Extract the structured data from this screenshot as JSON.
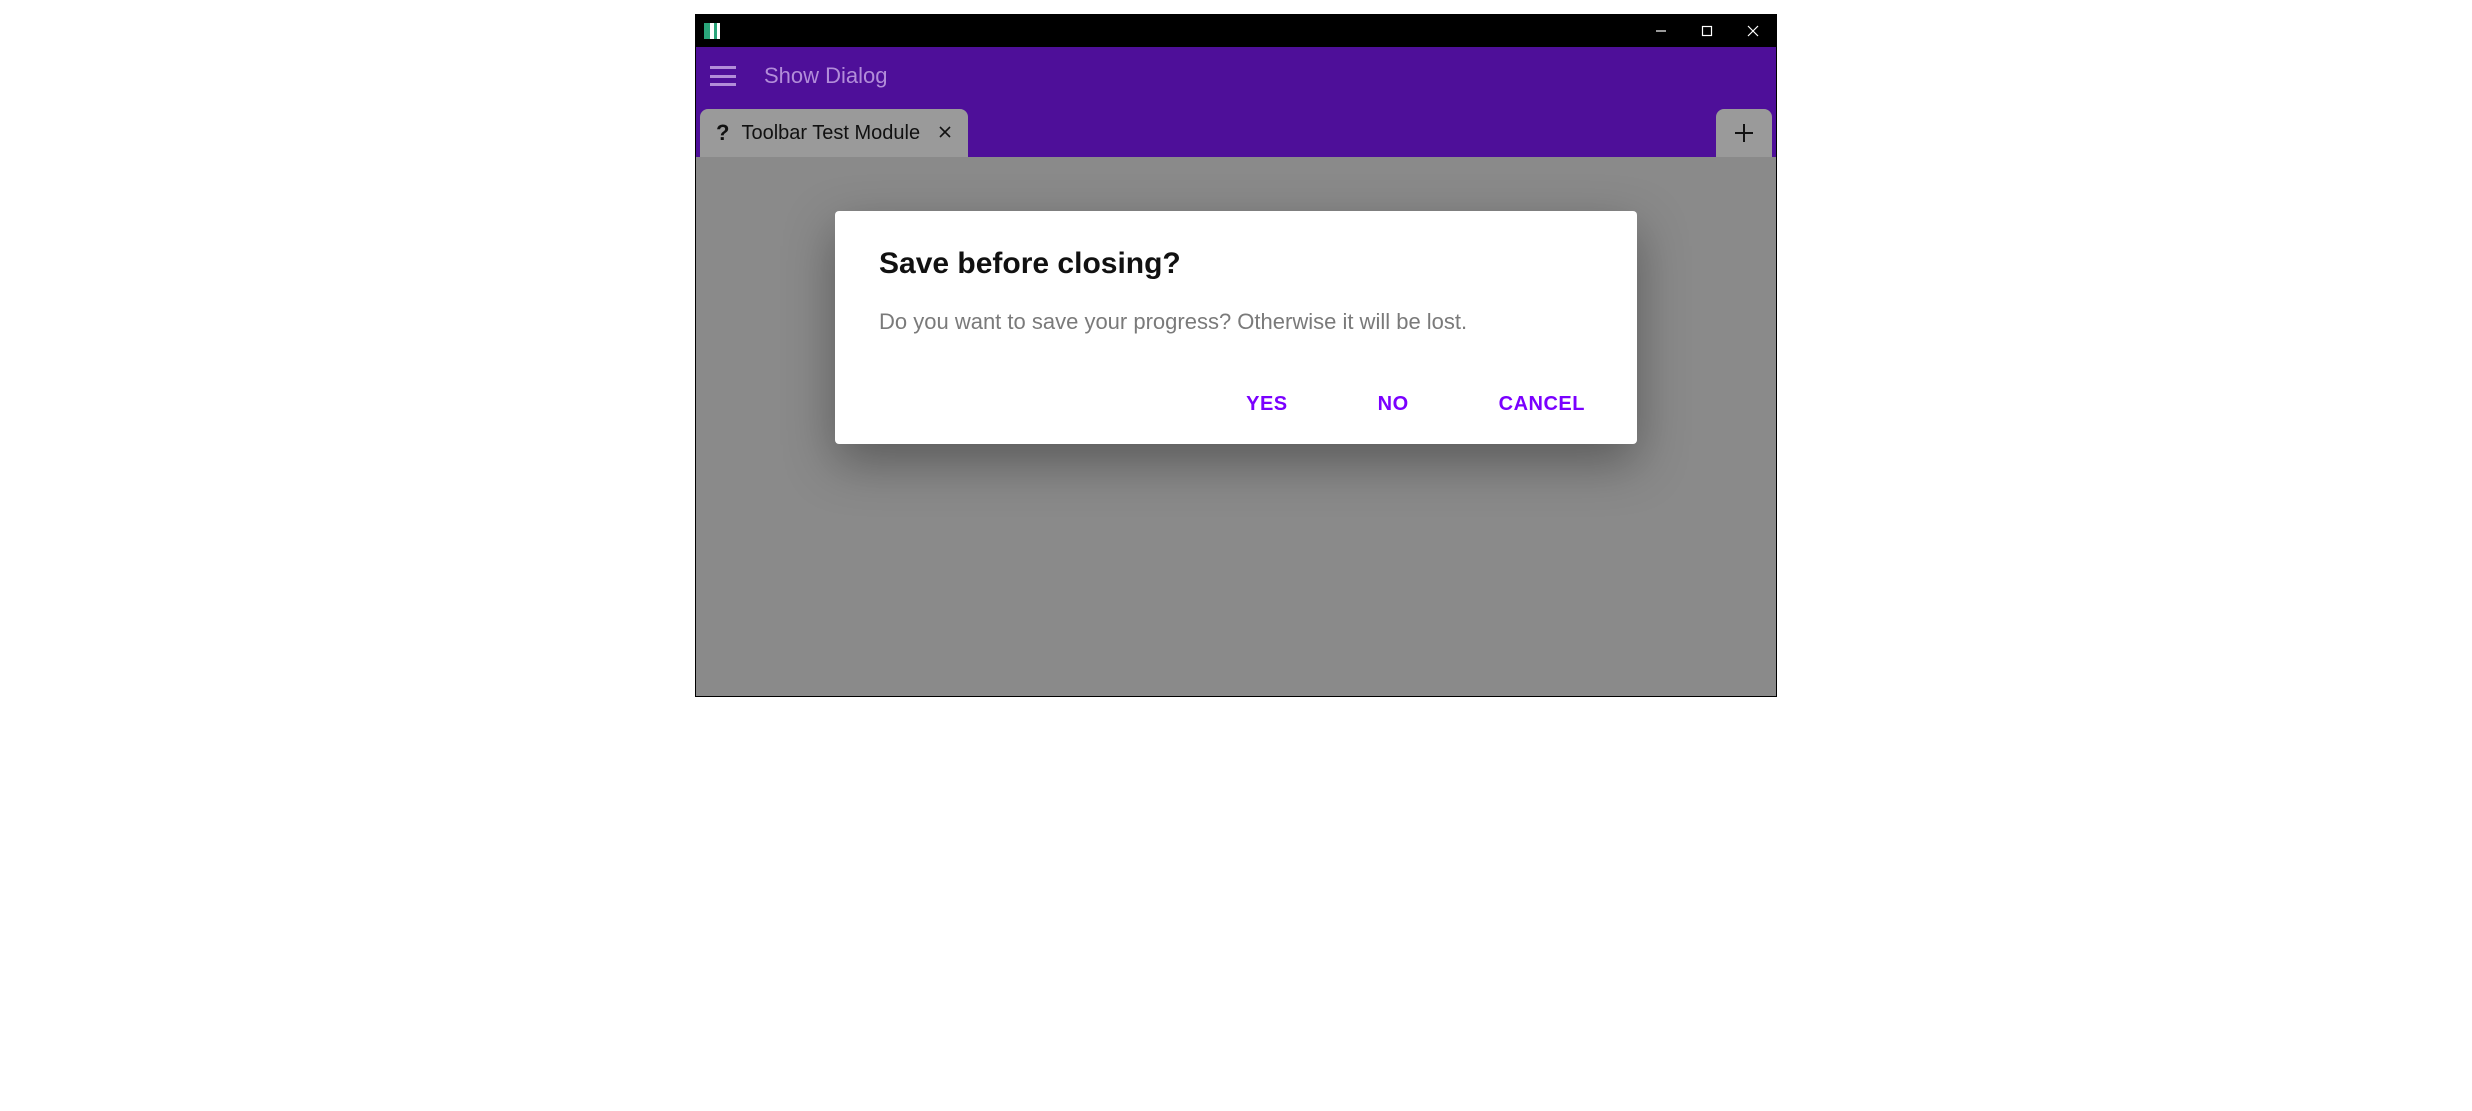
{
  "colors": {
    "accent": "#4e0f99",
    "button_text": "#7a00ff",
    "dim_purple": "#b28dd9",
    "overlay_grey": "#8a8a8a"
  },
  "header": {
    "title": "Show Dialog"
  },
  "tabs": [
    {
      "icon": "help",
      "label": "Toolbar Test Module",
      "closable": true
    }
  ],
  "dialog": {
    "title": "Save before closing?",
    "body": "Do you want to save your progress? Otherwise it will be lost.",
    "actions": {
      "yes": "YES",
      "no": "NO",
      "cancel": "CANCEL"
    }
  }
}
